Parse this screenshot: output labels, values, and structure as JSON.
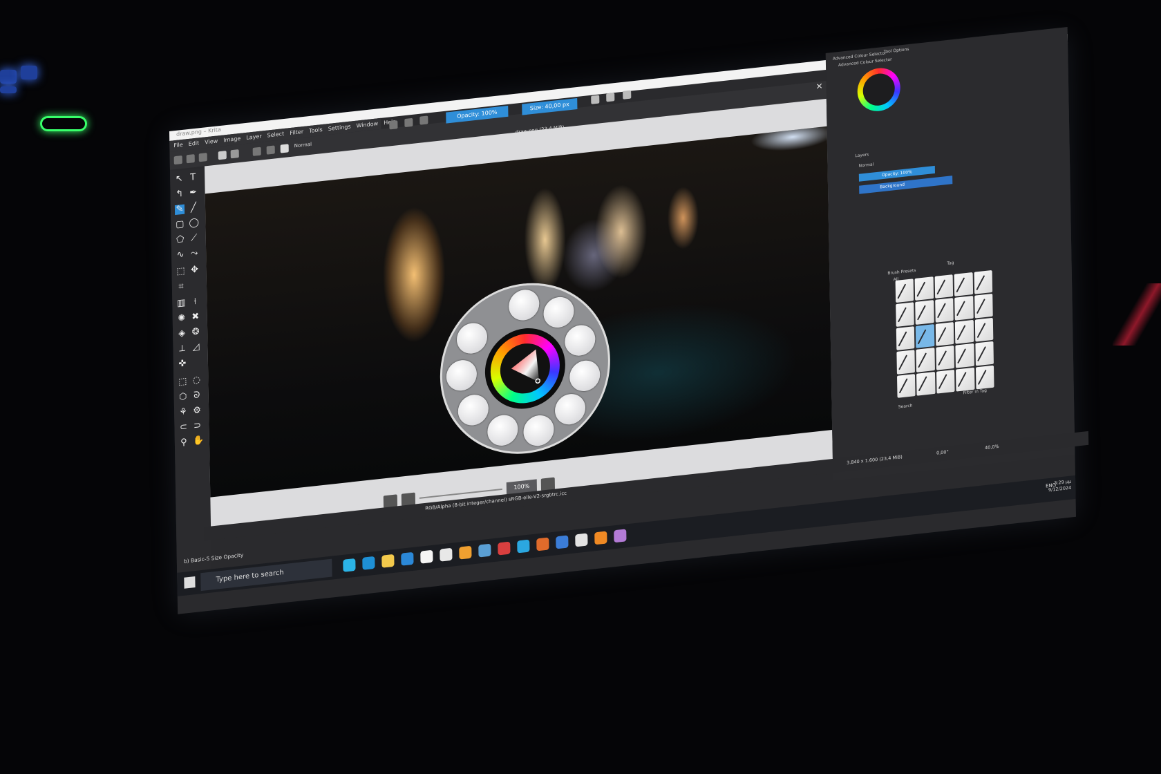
{
  "window": {
    "app_title": "draw.png – Krita",
    "controls": "–  ▢  ✕"
  },
  "menu": [
    "File",
    "Edit",
    "View",
    "Image",
    "Layer",
    "Select",
    "Filter",
    "Tools",
    "Settings",
    "Window",
    "Help"
  ],
  "toolbar": {
    "blending_mode": "Normal",
    "opacity": "Opacity: 100%",
    "size": "Size: 40,00 px"
  },
  "document": {
    "tab": "draw.png (23,4 MiB)"
  },
  "canvas_nav": {
    "zoom": "100%"
  },
  "dockers": {
    "advanced_colour_selector": "Advanced Colour Selector",
    "tool_options": "Tool Options",
    "layers_title": "Layers",
    "layer_blend": "Normal",
    "layer_opacity": "Opacity: 100%",
    "layer_name": "Background",
    "brush_presets_title": "Brush Presets",
    "tag_label": "Tag",
    "all_label": "All",
    "search_placeholder": "Search",
    "filter_in_tag": "Filter in Tag"
  },
  "status": {
    "preset_name": "b) Basic-5 Size Opacity",
    "color_info": "RGB/Alpha (8-bit integer/channel)  sRGB-elle-V2-srgbtrc.icc",
    "image_size": "3.840 x 1.600 (23,4 MiB)",
    "rotation": "0,00°",
    "zoom": "40,0%"
  },
  "taskbar": {
    "search_placeholder": "Type here to search",
    "lang": "ENG",
    "time": "3:29 μμ",
    "date": "9/12/2024",
    "app_colors": [
      "#2bb3e6",
      "#1e90d6",
      "#f2c94c",
      "#2b88d8",
      "#f5f5f5",
      "#e8e8e8",
      "#f0a030",
      "#5a9fd4",
      "#d93f3f",
      "#2ba7e0",
      "#e06b2b",
      "#3b7dd8",
      "#e3e3e3",
      "#f08a24",
      "#b37bd6"
    ]
  },
  "colors": {
    "accent_blue": "#2f8ed8",
    "dock_bg": "#2b2b2e",
    "led_green": "#38ff6a"
  }
}
